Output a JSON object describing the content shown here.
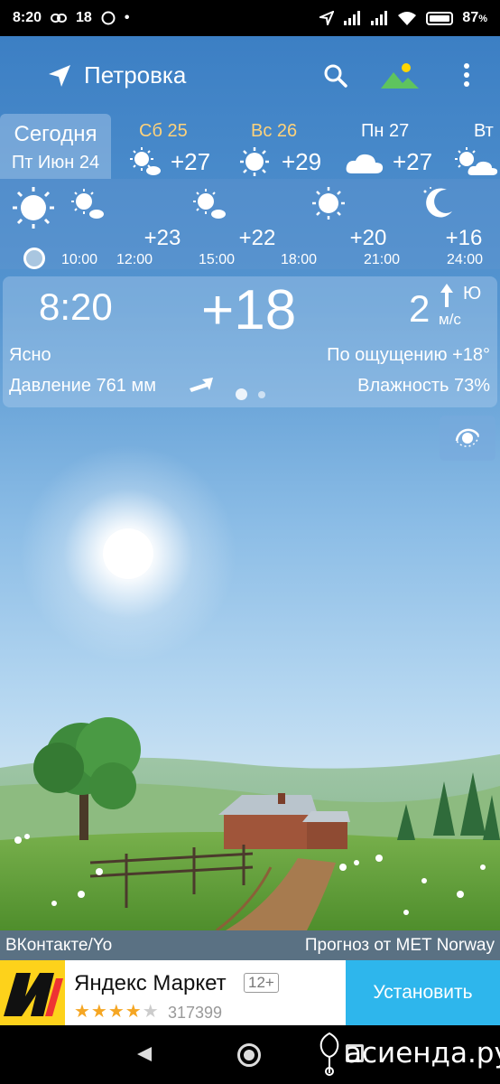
{
  "status_bar": {
    "time": "8:20",
    "temp": "18",
    "battery": "87",
    "battery_unit": "%"
  },
  "app_bar": {
    "location": "Петровка"
  },
  "days": {
    "today": {
      "label": "Сегодня",
      "date": "Пт Июн 24"
    },
    "items": [
      {
        "name": "Сб 25",
        "temp": "+27",
        "icon": "sun-icon"
      },
      {
        "name": "Вс 26",
        "temp": "+29",
        "icon": "sun-icon"
      },
      {
        "name": "Пн 27",
        "temp": "+27",
        "icon": "cloud-icon"
      },
      {
        "name": "Вт",
        "temp": "",
        "icon": "partly-cloudy-icon"
      }
    ]
  },
  "hourly": {
    "temps": [
      "+23",
      "+22",
      "+20",
      "+16"
    ],
    "times": [
      "10:00",
      "12:00",
      "15:00",
      "18:00",
      "21:00",
      "24:00"
    ]
  },
  "current": {
    "time": "8:20",
    "temp": "+18",
    "wind_speed": "2",
    "wind_unit": "м/с",
    "wind_dir": "Ю",
    "condition": "Ясно",
    "feels_like": "По ощущению +18°",
    "pressure": "Давление 761 мм",
    "humidity": "Влажность 73%"
  },
  "credits": {
    "left": "ВКонтакте/Yo",
    "right": "Прогноз от MET Norway"
  },
  "ad": {
    "name": "Яндекс Маркет",
    "age": "12+",
    "rating": 4,
    "count": "317399",
    "install": "Установить",
    "brand_color": "#fdd21b",
    "button_color": "#2eb6ec"
  },
  "watermark": "асиенда.ру"
}
